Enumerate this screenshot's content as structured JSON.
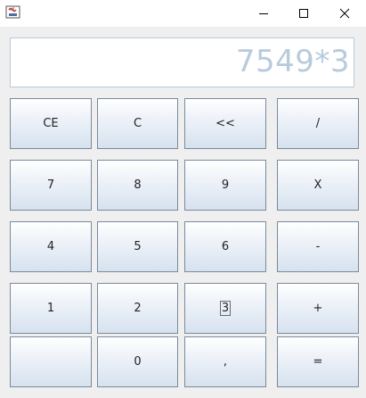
{
  "window": {
    "minimize_icon": "minimize-icon",
    "maximize_icon": "maximize-icon",
    "close_icon": "close-icon",
    "app_icon": "java-coffee-cup-icon"
  },
  "display": {
    "value": "7549*3",
    "text_color": "#b8cadd"
  },
  "keypad": {
    "ce": "CE",
    "c": "C",
    "backspace": "<<",
    "divide": "/",
    "seven": "7",
    "eight": "8",
    "nine": "9",
    "multiply": "X",
    "four": "4",
    "five": "5",
    "six": "6",
    "minus": "-",
    "one": "1",
    "two": "2",
    "three": "3",
    "plus": "+",
    "blank": "",
    "zero": "0",
    "decimal": ",",
    "equals": "="
  },
  "colors": {
    "button_top": "#ffffff",
    "button_bottom": "#d6e2ef",
    "button_border": "#7a8a9c"
  }
}
